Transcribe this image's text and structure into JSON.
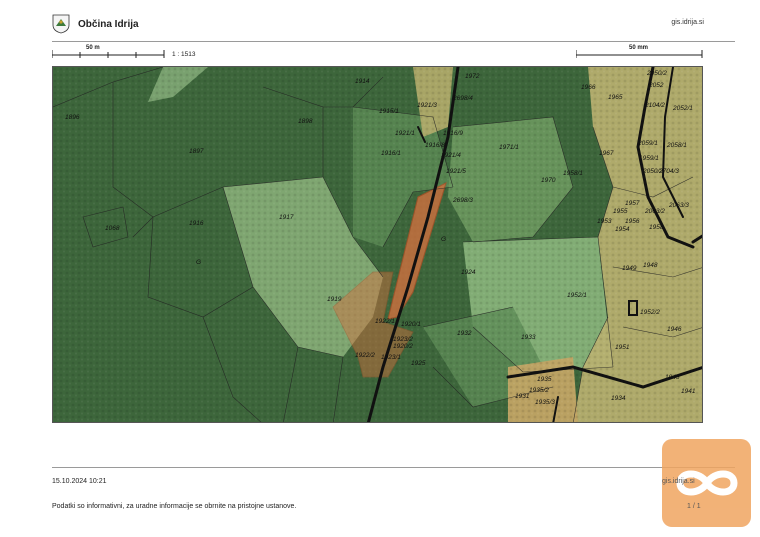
{
  "header": {
    "title": "Občina Idrija",
    "site": "gis.idrija.si",
    "logo_icon": "municipality-crest-icon"
  },
  "scale": {
    "left_label": "50 m",
    "right_label": "50 mm",
    "ratio": "1 : 1513"
  },
  "map": {
    "parcel_labels": [
      "1914",
      "1972",
      "2698/4",
      "1896",
      "1898",
      "1915/1",
      "1921/3",
      "1921/1",
      "1916/9",
      "1916/8",
      "1921/4",
      "1921/5",
      "1916/1",
      "1971/1",
      "1897",
      "1967",
      "1970",
      "1958/1",
      "2698/3",
      "1917",
      "1916",
      "1068",
      "1955",
      "1953",
      "1954",
      "1956",
      "1958",
      "1924",
      "1949",
      "1948",
      "1952/1",
      "1952/2",
      "1919",
      "1922/1",
      "1920/1",
      "1920/2",
      "1922/2",
      "1923/1",
      "1923/2",
      "1932",
      "1933",
      "1951",
      "1946",
      "1925",
      "1935",
      "1935/2",
      "1935/3",
      "1934",
      "1931",
      "1945",
      "1941",
      "1966",
      "1965",
      "2050/2",
      "2052",
      "2104/2",
      "2052/1",
      "2059/1",
      "2058/1",
      "1959/1",
      "2050/2",
      "2704/3",
      "2063/2",
      "2063/3",
      "1957",
      "G"
    ],
    "colors": {
      "forest": "#3f6b3f",
      "meadow": "#7fa570",
      "light_meadow": "#9cc08a",
      "built": "#c7b879",
      "highlight": "#d9713f",
      "road": "#111111"
    }
  },
  "footer": {
    "datetime": "15.10.2024 10:21",
    "site": "gis.idrija.si",
    "page": "1 / 1",
    "note": "Podatki so informativni, za uradne informacije se obrnite na pristojne ustanove."
  },
  "badge_icon": "infinity-icon"
}
